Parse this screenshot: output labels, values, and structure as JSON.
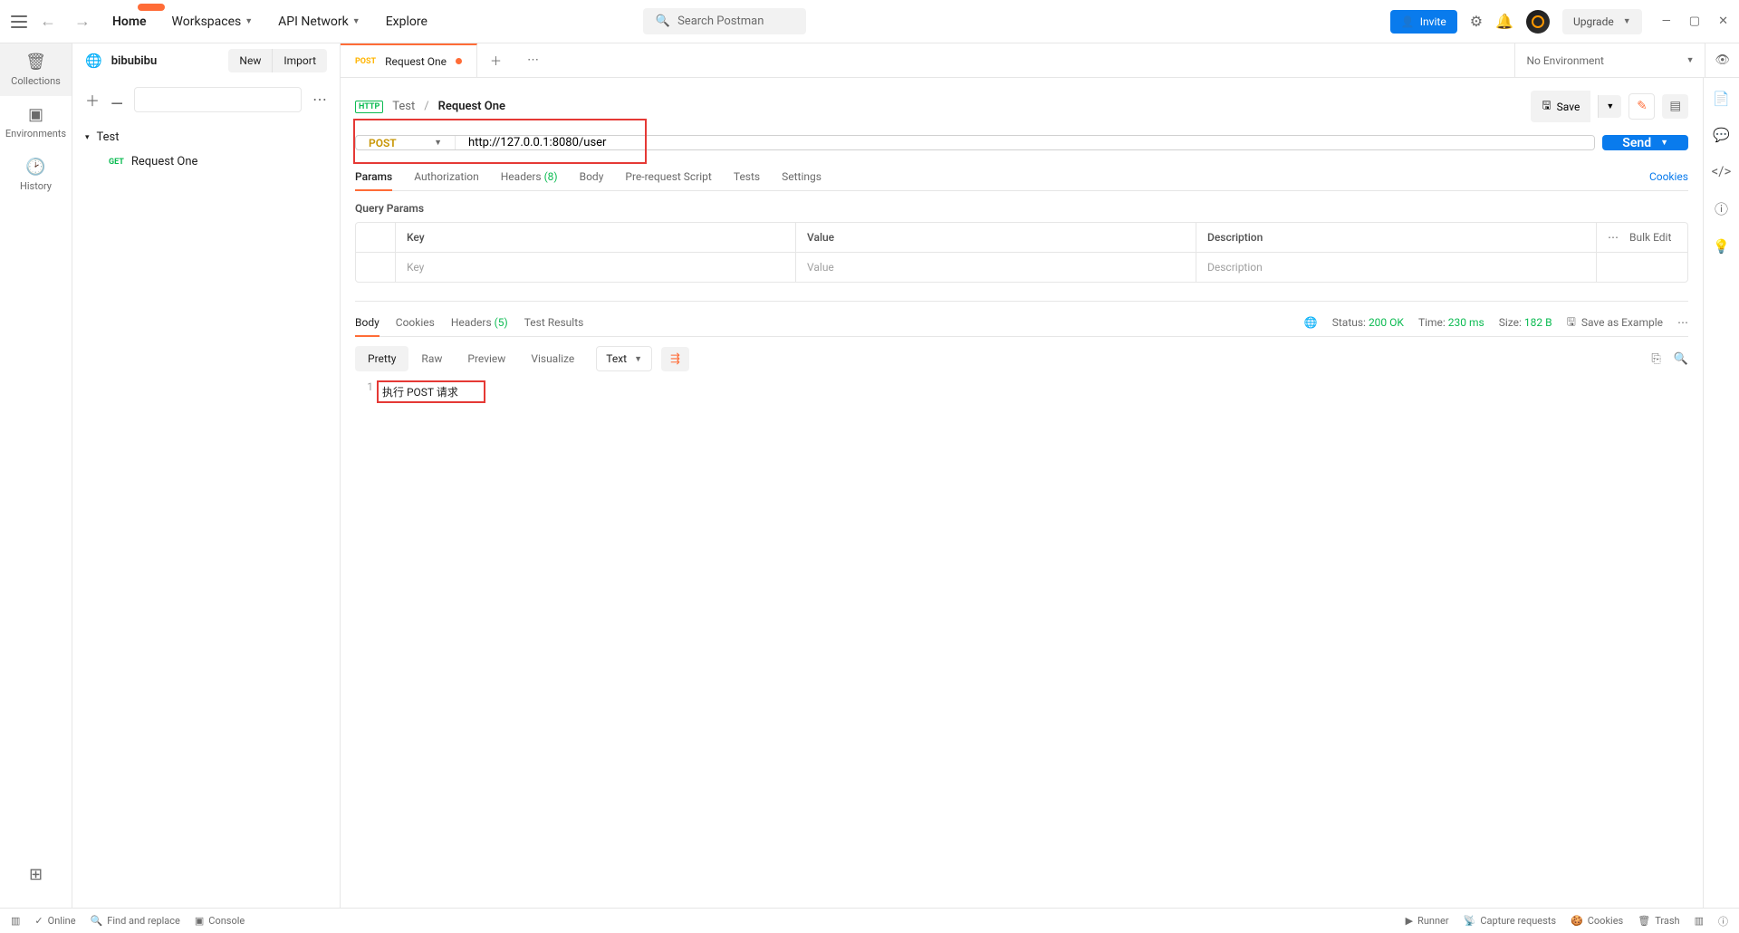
{
  "topbar": {
    "nav": {
      "home": "Home",
      "workspaces": "Workspaces",
      "api_network": "API Network",
      "explore": "Explore"
    },
    "search_placeholder": "Search Postman",
    "invite": "Invite",
    "upgrade": "Upgrade"
  },
  "workspace": {
    "name": "bibubibu",
    "new_btn": "New",
    "import_btn": "Import"
  },
  "rail": {
    "collections": "Collections",
    "environments": "Environments",
    "history": "History"
  },
  "tree": {
    "folder": "Test",
    "req_method": "GET",
    "req_name": "Request One"
  },
  "tab": {
    "method": "POST",
    "name": "Request One"
  },
  "env": {
    "selected": "No Environment"
  },
  "breadcrumb": {
    "folder": "Test",
    "name": "Request One",
    "save": "Save"
  },
  "request": {
    "method": "POST",
    "url": "http://127.0.0.1:8080/user",
    "send": "Send",
    "tabs": {
      "params": "Params",
      "auth": "Authorization",
      "headers": "Headers",
      "headers_count": "(8)",
      "body": "Body",
      "prereq": "Pre-request Script",
      "tests": "Tests",
      "settings": "Settings"
    },
    "cookies": "Cookies",
    "query_title": "Query Params",
    "table": {
      "key": "Key",
      "value": "Value",
      "desc": "Description",
      "key_ph": "Key",
      "value_ph": "Value",
      "desc_ph": "Description",
      "bulk": "Bulk Edit"
    }
  },
  "response": {
    "tabs": {
      "body": "Body",
      "cookies": "Cookies",
      "headers": "Headers",
      "headers_count": "(5)",
      "tests": "Test Results"
    },
    "meta": {
      "status_lbl": "Status:",
      "status": "200 OK",
      "time_lbl": "Time:",
      "time": "230 ms",
      "size_lbl": "Size:",
      "size": "182 B",
      "save_example": "Save as Example"
    },
    "views": {
      "pretty": "Pretty",
      "raw": "Raw",
      "preview": "Preview",
      "visualize": "Visualize",
      "lang": "Text"
    },
    "body_line": "执行 POST 请求"
  },
  "statusbar": {
    "online": "Online",
    "find": "Find and replace",
    "console": "Console",
    "runner": "Runner",
    "capture": "Capture requests",
    "cookies": "Cookies",
    "trash": "Trash"
  }
}
